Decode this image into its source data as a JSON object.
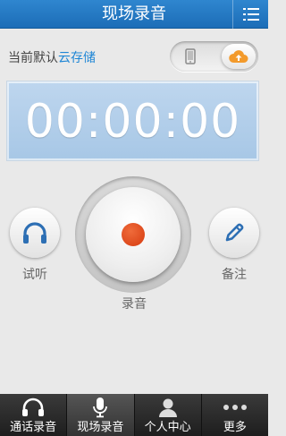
{
  "header": {
    "title": "现场录音",
    "menu_icon": "list-menu-icon"
  },
  "storage": {
    "prefix": "当前默认",
    "location": "云存储",
    "options": [
      "phone-icon",
      "cloud-upload-icon"
    ],
    "selected": "cloud",
    "accent_color": "#1f86d5",
    "cloud_color": "#f39a2b"
  },
  "timer": {
    "value": "00:00:00"
  },
  "actions": {
    "listen_label": "试听",
    "record_label": "录音",
    "note_label": "备注"
  },
  "tabs": [
    {
      "label": "通话录音",
      "icon": "phone-handset-icon",
      "active": false
    },
    {
      "label": "现场录音",
      "icon": "microphone-icon",
      "active": true
    },
    {
      "label": "个人中心",
      "icon": "user-icon",
      "active": false
    },
    {
      "label": "更多",
      "icon": "more-dots-icon",
      "active": false
    }
  ],
  "colors": {
    "header_blue": "#1c6db7",
    "timer_blue": "#a7c7e6",
    "record_red": "#d63b10",
    "tabbar_dark": "#1e1e1e"
  }
}
